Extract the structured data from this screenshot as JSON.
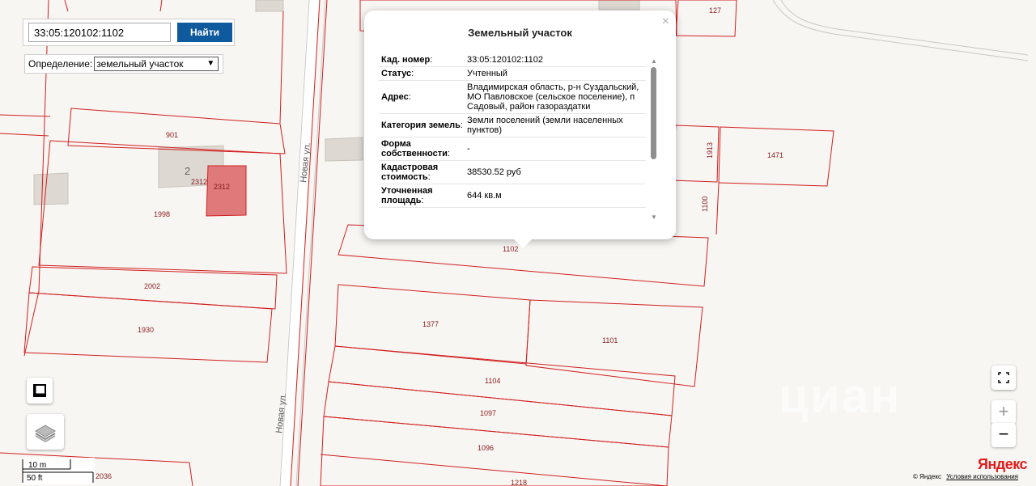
{
  "search": {
    "value": "33:05:120102:1102",
    "button_label": "Найти"
  },
  "definition": {
    "label": "Определение:",
    "selected": "земельный участок"
  },
  "popup": {
    "title": "Земельный участок",
    "close_symbol": "×",
    "rows": [
      {
        "label": "Кад. номер",
        "colon": ":",
        "value": "33:05:120102:1102"
      },
      {
        "label": "Статус",
        "colon": ":",
        "value": "Учтенный"
      },
      {
        "label": "Адрес",
        "colon": ":",
        "value": "Владимирская область, р-н Суздальский, МО Павловское (сельское поселение), п Садовый, район газораздатки"
      },
      {
        "label": "Категория земель",
        "colon": ":",
        "value": "Земли поселений (земли населенных пунктов)"
      },
      {
        "label": "Форма собственности",
        "colon": ":",
        "value": "-"
      },
      {
        "label": "Кадастровая стоимость",
        "colon": ":",
        "value": "38530.52 руб"
      },
      {
        "label": "Уточненная площадь",
        "colon": ":",
        "value": "644 кв.м"
      }
    ]
  },
  "map": {
    "plot_labels": [
      "127",
      "901",
      "2",
      "2312",
      "2312",
      "1998",
      "1913",
      "1471",
      "1100",
      "1102",
      "2002",
      "1930",
      "1377",
      "1101",
      "1104",
      "1097",
      "1096",
      "1218",
      "2036"
    ],
    "street_labels": [
      "Новая ул.",
      "Новая ул."
    ],
    "plot_border_color": "#d21f1f",
    "highlight_color": "#e07a7a"
  },
  "controls": {
    "zoom_in": "+",
    "zoom_out": "−",
    "icons": [
      "fullscreen-icon",
      "layers-icon",
      "ruler-icon"
    ]
  },
  "scale": {
    "metric": "10 m",
    "imperial": "50 ft"
  },
  "footer": {
    "copyright": "© Яндекс",
    "terms_link": "Условия использования",
    "logo": "Яндекс",
    "watermark": "циан"
  }
}
